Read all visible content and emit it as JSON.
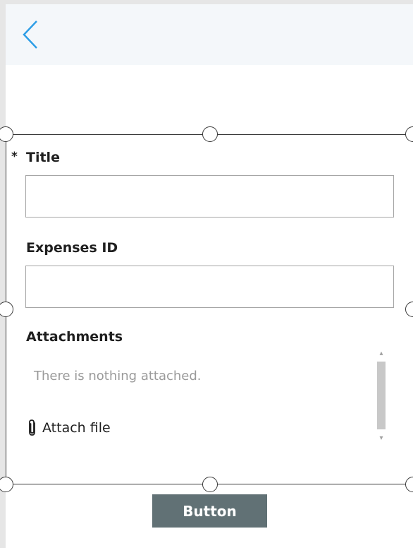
{
  "header": {
    "back_icon": "chevron-left-icon",
    "accent_color": "#2e9ee6"
  },
  "form": {
    "fields": [
      {
        "label": "Title",
        "required": true,
        "value": ""
      },
      {
        "label": "Expenses ID",
        "required": false,
        "value": ""
      }
    ],
    "required_marker": "*",
    "attachments": {
      "label": "Attachments",
      "empty_message": "There is nothing attached.",
      "attach_label": "Attach file",
      "attach_icon": "paperclip-icon"
    }
  },
  "button": {
    "label": "Button",
    "color": "#617175"
  }
}
